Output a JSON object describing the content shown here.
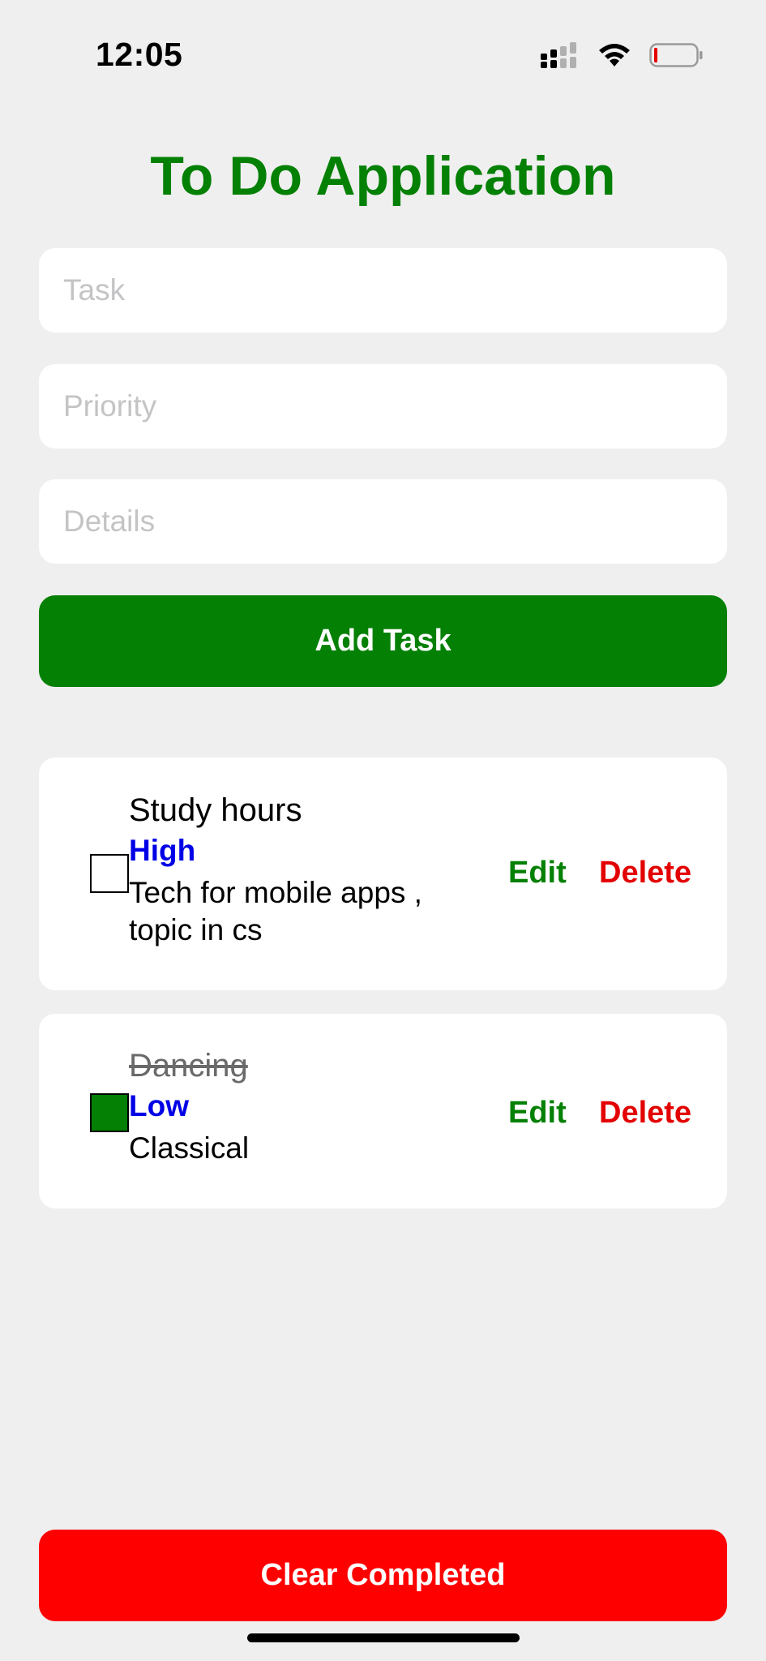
{
  "status_bar": {
    "time": "12:05"
  },
  "header": {
    "title": "To Do Application"
  },
  "form": {
    "task_placeholder": "Task",
    "priority_placeholder": "Priority",
    "details_placeholder": "Details",
    "add_label": "Add Task"
  },
  "tasks": [
    {
      "name": "Study hours",
      "priority": "High",
      "details": "Tech for mobile apps , topic in cs",
      "completed": false,
      "edit_label": "Edit",
      "delete_label": "Delete"
    },
    {
      "name": "Dancing",
      "priority": "Low",
      "details": "Classical",
      "completed": true,
      "edit_label": "Edit",
      "delete_label": "Delete"
    }
  ],
  "footer": {
    "clear_label": "Clear Completed"
  },
  "colors": {
    "accent_green": "#048004",
    "danger_red": "#ff0000",
    "priority_blue": "#0000e6",
    "background": "#efefef"
  }
}
